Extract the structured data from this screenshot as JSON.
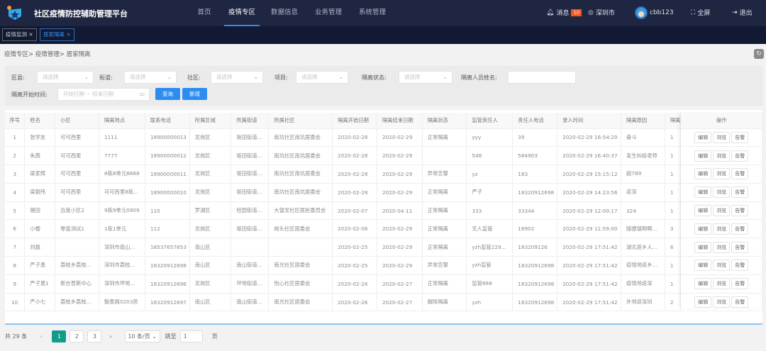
{
  "header": {
    "title": "社区疫情防控辅助管理平台",
    "nav": [
      "首页",
      "疫情专区",
      "数据信息",
      "业务管理",
      "系统管理"
    ],
    "active_nav": 1,
    "messages_label": "消息",
    "messages_count": "10",
    "location": "深圳市",
    "username": "cbb123",
    "fullscreen": "全屏",
    "logout": "退出"
  },
  "tabs": [
    {
      "label": "疫情监测",
      "close": "×"
    },
    {
      "label": "居家隔离",
      "close": "×"
    }
  ],
  "breadcrumb": "疫情专区> 疫情管理> 居家隔离",
  "filters": {
    "district_label": "区县:",
    "street_label": "街道:",
    "community_label": "社区:",
    "project_label": "项目:",
    "status_label": "隔离状态:",
    "name_label": "隔离人员姓名:",
    "start_label": "隔离开始时间:",
    "placeholder": "请选择",
    "date_start": "开始日期",
    "date_sep": "~",
    "date_end": "结束日期",
    "query": "查询",
    "add": "新增"
  },
  "table": {
    "columns": [
      "序号",
      "姓名",
      "小区",
      "隔离地点",
      "联系电话",
      "所属区域",
      "所属街道",
      "所属社区",
      "隔离开始日期",
      "隔离结束日期",
      "隔离状态",
      "监管责任人",
      "责任人电话",
      "录入时间",
      "隔离原因",
      "隔离",
      "操作"
    ],
    "actions": [
      "编辑",
      "浏览",
      "告警"
    ],
    "rows": [
      [
        "1",
        "张学友",
        "可可西里",
        "1111",
        "18900000013",
        "龙岗区",
        "坂田街道...",
        "南坑社区南坑居委会",
        "2020-02-28",
        "2020-02-29",
        "正常隔离",
        "yyy",
        "39",
        "2020-02-29 16:54:20",
        "奋斗",
        "1"
      ],
      [
        "2",
        "朱茜",
        "可可西里",
        "7777",
        "18900000012",
        "龙岗区",
        "坂田街道...",
        "南坑社区南坑居委会",
        "2020-02-28",
        "2020-02-29",
        "",
        "548",
        "584903",
        "2020-02-29 16:40:37",
        "发生纠纷老师",
        "1"
      ],
      [
        "3",
        "梁家辉",
        "可可西里",
        "8栋8单元8888",
        "18900000011",
        "龙岗区",
        "坂田街道...",
        "南坑社区南坑居委会",
        "2020-02-28",
        "2020-02-29",
        "异常告警",
        "yz",
        "183",
        "2020-02-29 15:15:12",
        "超789",
        "1"
      ],
      [
        "4",
        "梁朝伟",
        "可可西里",
        "可可西里8栋...",
        "18900000010",
        "龙岗区",
        "坂田街道...",
        "南坑社区南坑居委会",
        "2020-02-28",
        "2020-02-29",
        "正常隔离",
        "严子",
        "18320912698",
        "2020-02-29 14:23:56",
        "返深",
        "1"
      ],
      [
        "5",
        "猪田",
        "百度小区2",
        "9栋9单元0909",
        "110",
        "罗湖区",
        "桂园街道...",
        "大望龙社区居民委员会",
        "2020-02-07",
        "2020-04-11",
        "正常隔离",
        "333",
        "33344",
        "2020-02-29 12:00:17",
        "324",
        "1"
      ],
      [
        "6",
        "小樱",
        "零壹测试1",
        "1栋1单元",
        "112",
        "龙岗区",
        "坂田街道...",
        "岗头社区居委会",
        "2020-02-06",
        "2020-02-29",
        "正常隔离",
        "无人监管",
        "18902",
        "2020-02-29 11:59:00",
        "随便填啊啊...",
        "3"
      ],
      [
        "7",
        "刘磊",
        "",
        "深圳市南山...",
        "18537657653",
        "南山区",
        "",
        "",
        "2020-02-25",
        "2020-02-29",
        "正常隔离",
        "yzh监管229...",
        "183209126",
        "2020-02-29 17:51:42",
        "湖北返乡人...",
        "6"
      ],
      [
        "8",
        "严子恩",
        "荔枝乡荔枝...",
        "深圳市荔枝...",
        "18320912698",
        "南山区",
        "南山街道...",
        "南光社区居委会",
        "2020-02-25",
        "2020-02-29",
        "异常告警",
        "yzh监管",
        "18320912698",
        "2020-02-29 17:51:42",
        "疫情地返乡...",
        "1"
      ],
      [
        "9",
        "严子恩1",
        "新台普斯中心",
        "深圳市坪地...",
        "18320912696",
        "龙岗区",
        "坪地街道...",
        "怡心社区居委会",
        "2020-02-26",
        "2020-02-27",
        "正常隔离",
        "监管888",
        "18320912698",
        "2020-02-29 17:51:42",
        "疫情地返深",
        "1"
      ],
      [
        "10",
        "严小七",
        "荔枝乡荔枝...",
        "魁墨阁0203房",
        "18320912697",
        "南山区",
        "南山街道...",
        "南光社区居委会",
        "2020-02-26",
        "2020-02-27",
        "解除隔离",
        "yzh",
        "18320912698",
        "2020-02-29 17:51:42",
        "外地返深圳",
        "2"
      ]
    ]
  },
  "pagination": {
    "total": "共 29 条",
    "prev": "‹",
    "pages": [
      "1",
      "2",
      "3"
    ],
    "current": "1",
    "next": "›",
    "page_size": "10 条/页",
    "goto_label": "跳至",
    "goto_value": "1",
    "page_suffix": "页"
  }
}
